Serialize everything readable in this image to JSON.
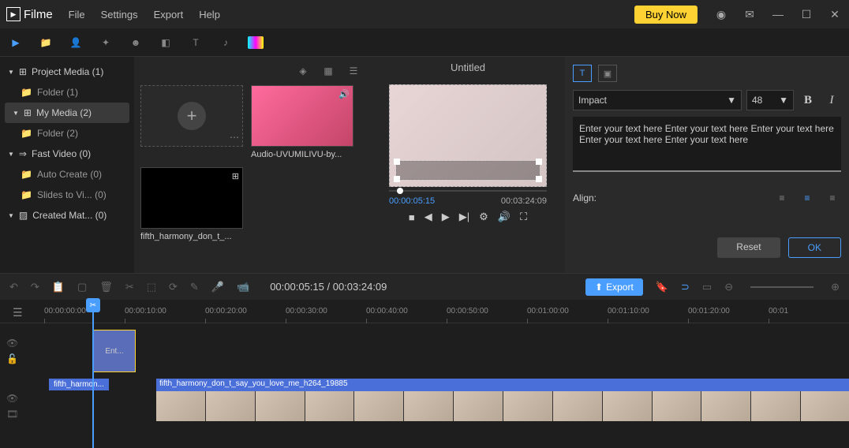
{
  "app": {
    "name": "Filme",
    "buy_now": "Buy Now"
  },
  "menu": [
    "File",
    "Settings",
    "Export",
    "Help"
  ],
  "sidebar": {
    "project_media": "Project Media (1)",
    "folder1": "Folder (1)",
    "my_media": "My Media (2)",
    "folder2": "Folder (2)",
    "fast_video": "Fast Video (0)",
    "auto_create": "Auto Create (0)",
    "slides": "Slides to Vi... (0)",
    "created_mat": "Created Mat... (0)"
  },
  "media": {
    "item1": "Audio-UVUMILIVU-by...",
    "item2": "fifth_harmony_don_t_..."
  },
  "preview": {
    "title": "Untitled",
    "current": "00:00:05:15",
    "duration": "00:03:24:09"
  },
  "text_panel": {
    "font": "Impact",
    "size": "48",
    "content": "Enter your text here Enter your text here Enter your text here Enter your text here Enter your text here",
    "align_label": "Align:",
    "reset": "Reset",
    "ok": "OK"
  },
  "tl_toolbar": {
    "time": "00:00:05:15 / 00:03:24:09",
    "export": "Export"
  },
  "ruler": [
    "00:00:00:00",
    "00:00:10:00",
    "00:00:20:00",
    "00:00:30:00",
    "00:00:40:00",
    "00:00:50:00",
    "00:01:00:00",
    "00:01:10:00",
    "00:01:20:00",
    "00:01"
  ],
  "clips": {
    "text": "Ent...",
    "video_short": "fifth_harmon...",
    "video_long": "fifth_harmony_don_t_say_you_love_me_h264_19885"
  }
}
